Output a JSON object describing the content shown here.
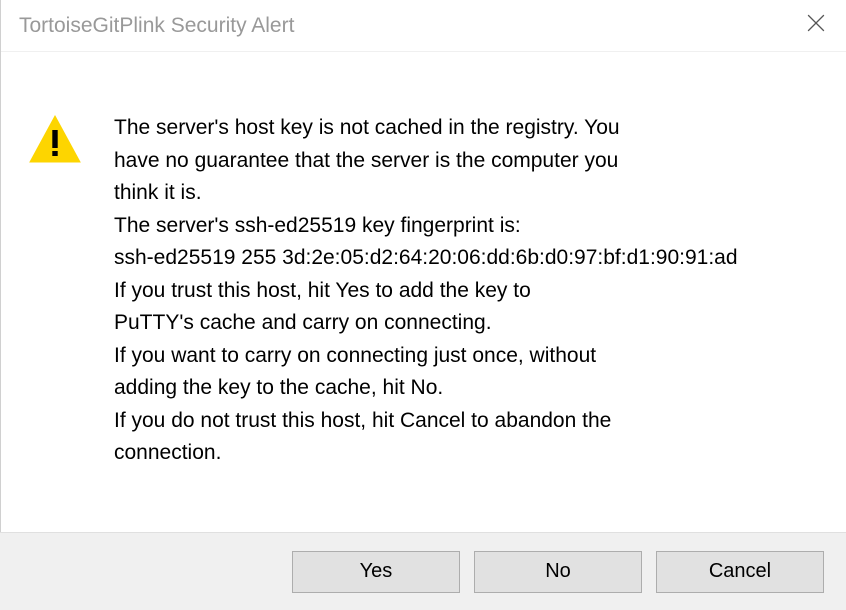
{
  "dialog": {
    "title": "TortoiseGitPlink Security Alert",
    "message": {
      "line1": "The server's host key is not cached in the registry. You",
      "line2": "have no guarantee that the server is the computer you",
      "line3": "think it is.",
      "line4": "The server's ssh-ed25519 key fingerprint is:",
      "line5": "ssh-ed25519 255 3d:2e:05:d2:64:20:06:dd:6b:d0:97:bf:d1:90:91:ad",
      "line6": "If you trust this host, hit Yes to add the key to",
      "line7": "PuTTY's cache and carry on connecting.",
      "line8": "If you want to carry on connecting just once, without",
      "line9": "adding the key to the cache, hit No.",
      "line10": "If you do not trust this host, hit Cancel to abandon the",
      "line11": "connection."
    },
    "buttons": {
      "yes": "Yes",
      "no": "No",
      "cancel": "Cancel"
    }
  }
}
